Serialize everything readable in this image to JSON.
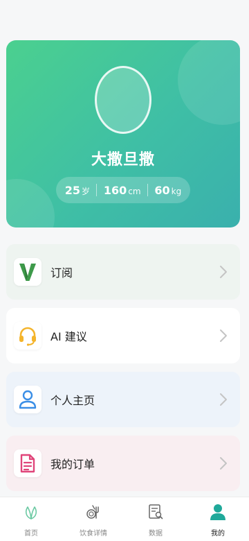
{
  "profile": {
    "name": "大撒旦撒",
    "stats": [
      {
        "value": "25",
        "unit": "岁"
      },
      {
        "value": "160",
        "unit": "cm"
      },
      {
        "value": "60",
        "unit": "kg"
      }
    ]
  },
  "menu": [
    {
      "label": "订阅",
      "icon": "v-icon",
      "bg": "#eef4f0"
    },
    {
      "label": "AI 建议",
      "icon": "headset-icon",
      "bg": "#ffffff"
    },
    {
      "label": "个人主页",
      "icon": "person-icon",
      "bg": "#edf3fa"
    },
    {
      "label": "我的订单",
      "icon": "order-icon",
      "bg": "#f9eef1"
    }
  ],
  "nav": [
    {
      "label": "首页",
      "icon": "leaf-icon"
    },
    {
      "label": "饮食详情",
      "icon": "food-icon"
    },
    {
      "label": "数据",
      "icon": "data-icon"
    },
    {
      "label": "我的",
      "icon": "profile-icon",
      "active": true
    }
  ],
  "colors": {
    "brand_green": "#4bd08f",
    "brand_teal": "#3ab0ad",
    "icon_v": "#3e9a4a",
    "icon_headset": "#f4b42b",
    "icon_person": "#3a8ee6",
    "icon_order": "#e0457a",
    "nav_active": "#1fa99a"
  }
}
